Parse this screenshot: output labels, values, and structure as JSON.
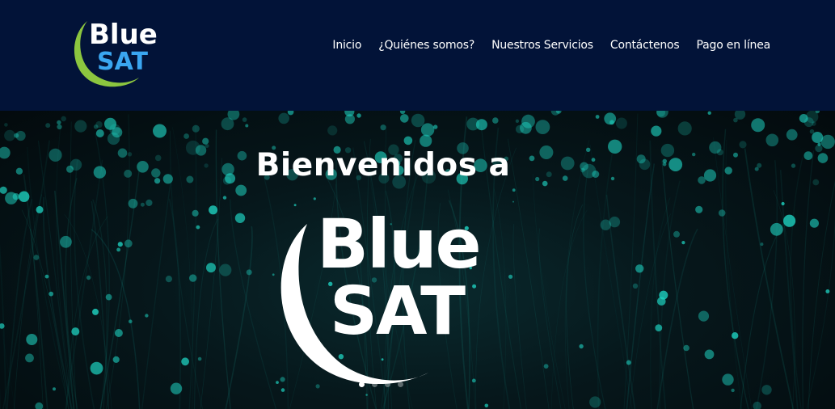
{
  "header": {
    "logo": {
      "line1": "Blue",
      "line2": "SAT",
      "colors": {
        "line1": "#ffffff",
        "line2": "#3aa6f0",
        "crescent": "#8cc63f"
      }
    },
    "nav": [
      {
        "label": "Inicio"
      },
      {
        "label": "¿Quiénes somos?"
      },
      {
        "label": "Nuestros Servicios"
      },
      {
        "label": "Contáctenos"
      },
      {
        "label": "Pago en línea"
      }
    ],
    "background": "#021338"
  },
  "hero": {
    "title": "Bienvenidos a",
    "logo": {
      "line1": "Blue",
      "line2": "SAT",
      "color": "#ffffff"
    },
    "slides": {
      "count": 4,
      "active": 0
    },
    "accent": "#1fd6c4"
  }
}
